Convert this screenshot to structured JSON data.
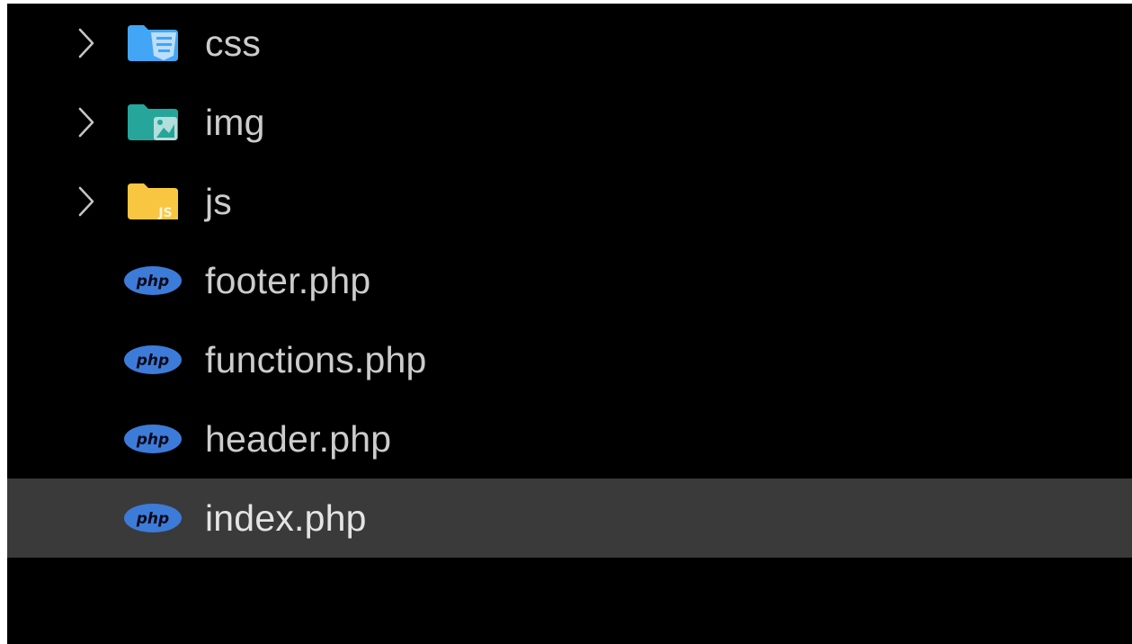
{
  "explorer": {
    "items": [
      {
        "label": "css",
        "kind": "folder",
        "icon": "css-folder-icon",
        "expanded": false
      },
      {
        "label": "img",
        "kind": "folder",
        "icon": "image-folder-icon",
        "expanded": false
      },
      {
        "label": "js",
        "kind": "folder",
        "icon": "js-folder-icon",
        "expanded": false
      },
      {
        "label": "footer.php",
        "kind": "file",
        "icon": "php-icon"
      },
      {
        "label": "functions.php",
        "kind": "file",
        "icon": "php-icon"
      },
      {
        "label": "header.php",
        "kind": "file",
        "icon": "php-icon"
      },
      {
        "label": "index.php",
        "kind": "file",
        "icon": "php-icon",
        "selected": true
      }
    ],
    "icon_badges": {
      "js": "JS",
      "php": "php"
    },
    "colors": {
      "background": "#000000",
      "selected_row": "#3a3a3a",
      "label_text": "#cccccc",
      "chevron": "#c5c5c5",
      "css_folder": "#42a5f5",
      "image_folder": "#26a69a",
      "js_folder": "#f9c642",
      "php_badge": "#3d7bd9"
    }
  }
}
